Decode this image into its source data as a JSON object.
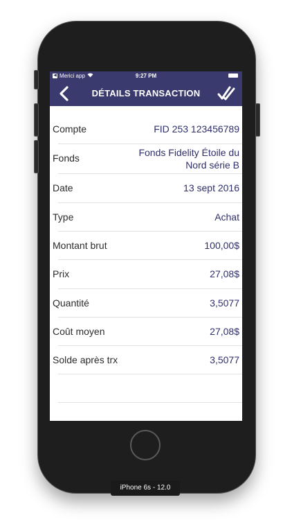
{
  "status_bar": {
    "carrier": "Merici app",
    "time": "9:27 PM"
  },
  "nav": {
    "title": "DÉTAILS TRANSACTION",
    "back_icon": "chevron-left-icon",
    "confirm_icon": "double-check-icon"
  },
  "rows": [
    {
      "label": "Compte",
      "value": "FID 253 123456789"
    },
    {
      "label": "Fonds",
      "value": "Fonds Fidelity Étoile du Nord série B"
    },
    {
      "label": "Date",
      "value": "13 sept 2016"
    },
    {
      "label": "Type",
      "value": "Achat"
    },
    {
      "label": "Montant brut",
      "value": "100,00$"
    },
    {
      "label": "Prix",
      "value": "27,08$"
    },
    {
      "label": "Quantité",
      "value": "3,5077"
    },
    {
      "label": "Coût moyen",
      "value": "27,08$"
    },
    {
      "label": "Solde après trx",
      "value": "3,5077"
    }
  ],
  "device_label": "iPhone 6s - 12.0",
  "colors": {
    "nav_bg": "#3a3a6e",
    "value_text": "#2e2e6a"
  }
}
